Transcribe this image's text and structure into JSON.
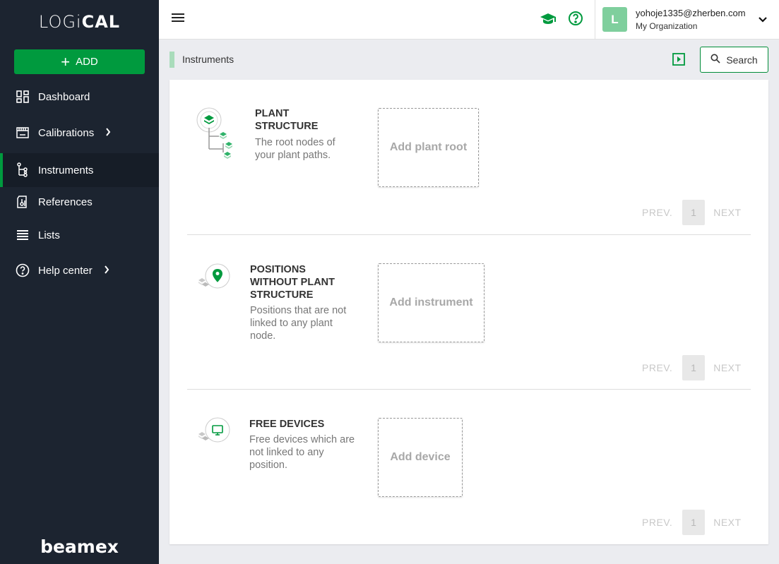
{
  "app": {
    "logo_light": "LOGi",
    "logo_bold": "CAL",
    "brand_footer": "beamex",
    "accent_color": "#009a3e"
  },
  "sidebar": {
    "add_label": "ADD",
    "items": [
      {
        "label": "Dashboard",
        "icon": "dashboard-icon",
        "has_submenu": false
      },
      {
        "label": "Calibrations",
        "icon": "calibrations-icon",
        "has_submenu": true
      },
      {
        "label": "Instruments",
        "icon": "instruments-icon",
        "has_submenu": false,
        "active": true
      },
      {
        "label": "References",
        "icon": "references-icon",
        "has_submenu": false
      },
      {
        "label": "Lists",
        "icon": "list-icon",
        "has_submenu": false
      },
      {
        "label": "Help center",
        "icon": "help-icon",
        "has_submenu": true
      }
    ]
  },
  "header": {
    "user_initial": "L",
    "user_email": "yohoje1335@zherben.com",
    "user_org": "My Organization"
  },
  "breadcrumb": {
    "current": "Instruments",
    "search_label": "Search"
  },
  "sections": [
    {
      "title": "PLANT STRUCTURE",
      "description": "The root nodes of your plant paths.",
      "add_label": "Add plant root",
      "pager": {
        "prev": "PREV.",
        "page": "1",
        "next": "NEXT"
      }
    },
    {
      "title": "POSITIONS WITHOUT PLANT STRUCTURE",
      "description": "Positions that are not linked to any plant node.",
      "add_label": "Add instrument",
      "pager": {
        "prev": "PREV.",
        "page": "1",
        "next": "NEXT"
      }
    },
    {
      "title": "FREE DEVICES",
      "description": "Free devices which are not linked to any position.",
      "add_label": "Add device",
      "pager": {
        "prev": "PREV.",
        "page": "1",
        "next": "NEXT"
      }
    }
  ]
}
